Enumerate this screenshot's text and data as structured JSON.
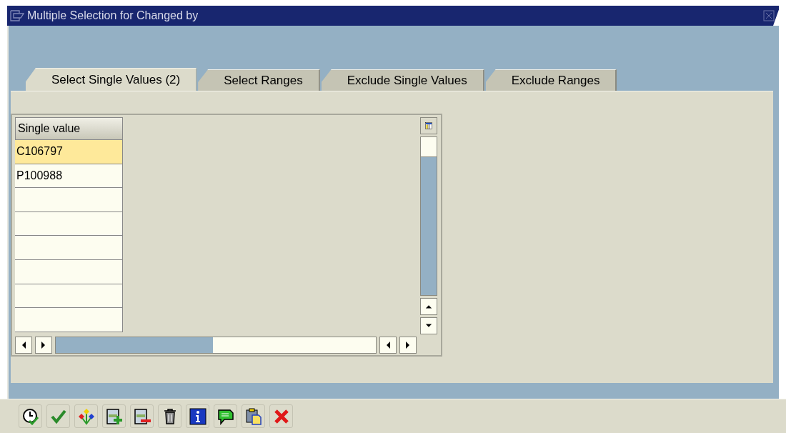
{
  "window": {
    "title": "Multiple Selection for Changed by"
  },
  "tabs": [
    {
      "label": "Select Single Values (2)",
      "selected": true
    },
    {
      "label": "Select Ranges",
      "selected": false
    },
    {
      "label": "Exclude Single Values",
      "selected": false
    },
    {
      "label": "Exclude Ranges",
      "selected": false
    }
  ],
  "table": {
    "columns": [
      "Single value"
    ],
    "rows": [
      {
        "value": "C106797",
        "selected": true
      },
      {
        "value": "P100988",
        "selected": false
      }
    ]
  }
}
